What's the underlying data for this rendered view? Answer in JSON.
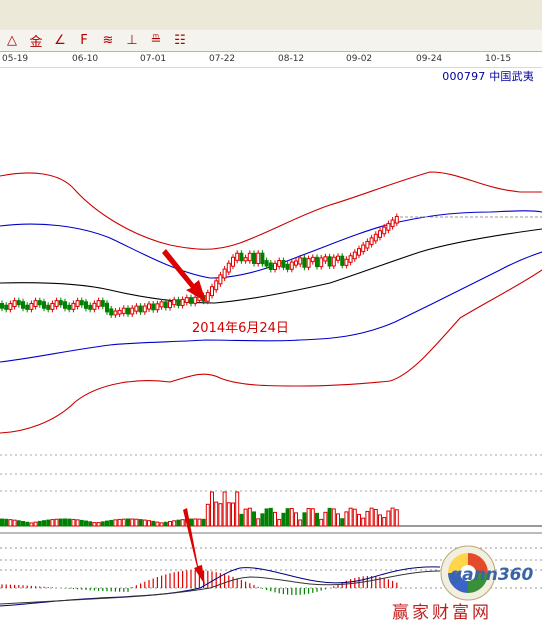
{
  "window": {
    "toolbar_icons": [
      "trend-line-icon",
      "gold-tool-icon",
      "angle-tool-icon",
      "fib-tool-icon",
      "fan-tool-icon",
      "period-tool-icon",
      "speed-tool-icon",
      "gann-box-icon"
    ]
  },
  "toolbar": {
    "labels": [
      "△",
      "金",
      "∠",
      "F",
      "≋",
      "⊥",
      "≞",
      "☷"
    ]
  },
  "dates": [
    "05-19",
    "06-10",
    "07-01",
    "07-22",
    "08-12",
    "09-02",
    "09-24",
    "10-15"
  ],
  "stock": {
    "code": "000797",
    "name": "中国武夷"
  },
  "annotation": {
    "text": "2014年6月24日"
  },
  "watermark": {
    "brand": "gann360",
    "slogan": "赢家财富网"
  },
  "colors": {
    "up": "#e00000",
    "down": "#008000",
    "band_outer": "#cc0000",
    "band_inner": "#0000cc",
    "ma": "#000000"
  }
}
